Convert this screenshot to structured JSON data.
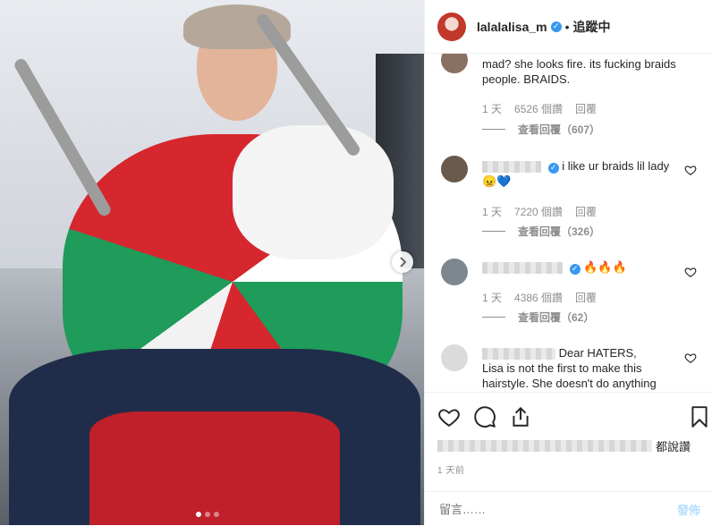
{
  "header": {
    "username": "lalalalisa_m",
    "separator": "•",
    "follow_label": "追蹤中"
  },
  "comments": [
    {
      "text": "mad? she looks fire. its fucking braids people. BRAIDS.",
      "time": "1 天",
      "likes": "6526 個讚",
      "reply": "回覆",
      "view_replies": "查看回覆（607）"
    },
    {
      "text": "i like ur braids lil lady",
      "emoji": "😠💙",
      "time": "1 天",
      "likes": "7220 個讚",
      "reply": "回覆",
      "view_replies": "查看回覆（326）"
    },
    {
      "emoji": "🔥🔥🔥",
      "time": "1 天",
      "likes": "4386 個讚",
      "reply": "回覆",
      "view_replies": "查看回覆（62）"
    },
    {
      "text_lead": "Dear HATERS,",
      "text": "Lisa is not the first to make this hairstyle. She doesn't do anything"
    }
  ],
  "actions": {
    "likes_suffix": "都說讚",
    "time": "1 天前"
  },
  "add_comment": {
    "placeholder": "留言……",
    "post_label": "發佈"
  },
  "colors": {
    "verified": "#3897f0",
    "post_disabled": "#b2dffc",
    "muted": "#8e8e8e"
  }
}
